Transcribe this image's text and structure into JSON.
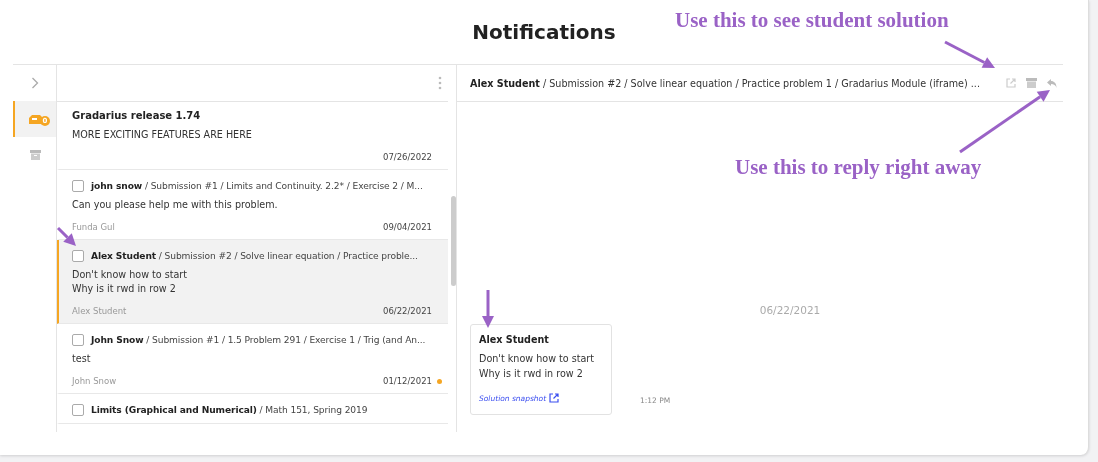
{
  "page_title": "Notifications",
  "annotations": [
    {
      "kind": "top",
      "text": "Use this to see student solution"
    },
    {
      "kind": "reply",
      "text": "Use this to reply right away"
    },
    {
      "kind": "checkbox"
    },
    {
      "kind": "card"
    }
  ],
  "rail": {
    "items": [
      {
        "kind": "inbox",
        "badge": "0",
        "selected": true
      },
      {
        "kind": "archive",
        "selected": false
      }
    ]
  },
  "list": {
    "items": [
      {
        "kind": "announcement",
        "title": "Gradarius release 1.74",
        "body": [
          "MORE EXCITING FEATURES ARE HERE"
        ],
        "date": "07/26/2022",
        "selected": false,
        "unread": false
      },
      {
        "kind": "message",
        "checked": false,
        "title": "**john snow** / Submission #1 / Limits and Continuity. 2.2* / Exercise 2 / M...",
        "body": [
          "Can you please help me with this problem."
        ],
        "author": "Funda Gul",
        "date": "09/04/2021",
        "selected": false,
        "unread": false
      },
      {
        "kind": "message",
        "checked": false,
        "title": "**Alex Student** / Submission #2 / Solve linear equation / Practice proble...",
        "body": [
          "Don't know how to start",
          "Why is it rwd in row 2"
        ],
        "author": "Alex Student",
        "date": "06/22/2021",
        "selected": true,
        "unread": false
      },
      {
        "kind": "message",
        "checked": false,
        "title": "**John Snow** / Submission #1 / 1.5 Problem 291 / Exercise 1 / Trig (and An...",
        "body": [
          "test"
        ],
        "author": "John Snow",
        "date": "01/12/2021",
        "selected": false,
        "unread": true
      },
      {
        "kind": "message",
        "checked": false,
        "title": "**Limits (Graphical and Numerical)** / Math 151, Spring 2019",
        "selected": false,
        "unread": false
      }
    ]
  },
  "detail": {
    "breadcrumb": "**Alex Student** / Submission #2 / Solve linear equation / Practice problem 1 / Gradarius Module (iframe) ...",
    "date_separator": "06/22/2021",
    "message": {
      "author": "Alex Student",
      "body": [
        "Don't know how to start",
        "Why is it rwd in row 2"
      ],
      "link": "Solution snapshot",
      "time": "1:12 PM"
    }
  }
}
